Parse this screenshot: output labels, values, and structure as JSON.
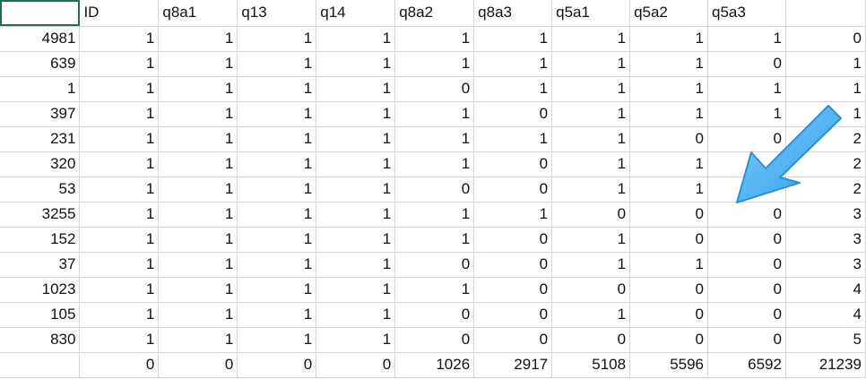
{
  "sheet": {
    "header": [
      "",
      "ID",
      "q8a1",
      "q13",
      "q14",
      "q8a2",
      "q8a3",
      "q5a1",
      "q5a2",
      "q5a3",
      ""
    ],
    "rows": [
      [
        "4981",
        "1",
        "1",
        "1",
        "1",
        "1",
        "1",
        "1",
        "1",
        "1",
        "0"
      ],
      [
        "639",
        "1",
        "1",
        "1",
        "1",
        "1",
        "1",
        "1",
        "1",
        "0",
        "1"
      ],
      [
        "1",
        "1",
        "1",
        "1",
        "1",
        "0",
        "1",
        "1",
        "1",
        "1",
        "1"
      ],
      [
        "397",
        "1",
        "1",
        "1",
        "1",
        "1",
        "0",
        "1",
        "1",
        "1",
        "1"
      ],
      [
        "231",
        "1",
        "1",
        "1",
        "1",
        "1",
        "1",
        "1",
        "0",
        "0",
        "2"
      ],
      [
        "320",
        "1",
        "1",
        "1",
        "1",
        "1",
        "0",
        "1",
        "1",
        "",
        "2"
      ],
      [
        "53",
        "1",
        "1",
        "1",
        "1",
        "0",
        "0",
        "1",
        "1",
        "",
        "2"
      ],
      [
        "3255",
        "1",
        "1",
        "1",
        "1",
        "1",
        "1",
        "0",
        "0",
        "0",
        "3"
      ],
      [
        "152",
        "1",
        "1",
        "1",
        "1",
        "1",
        "0",
        "1",
        "0",
        "0",
        "3"
      ],
      [
        "37",
        "1",
        "1",
        "1",
        "1",
        "0",
        "0",
        "1",
        "1",
        "0",
        "3"
      ],
      [
        "1023",
        "1",
        "1",
        "1",
        "1",
        "1",
        "0",
        "0",
        "0",
        "0",
        "4"
      ],
      [
        "105",
        "1",
        "1",
        "1",
        "1",
        "0",
        "0",
        "1",
        "0",
        "0",
        "4"
      ],
      [
        "830",
        "1",
        "1",
        "1",
        "1",
        "0",
        "0",
        "0",
        "0",
        "0",
        "5"
      ]
    ],
    "totals": [
      "",
      "0",
      "0",
      "0",
      "0",
      "1026",
      "2917",
      "5108",
      "5596",
      "6592",
      "21239"
    ]
  },
  "annotation": {
    "icon": "blue-arrow-icon",
    "color": "#3aa8f0"
  }
}
